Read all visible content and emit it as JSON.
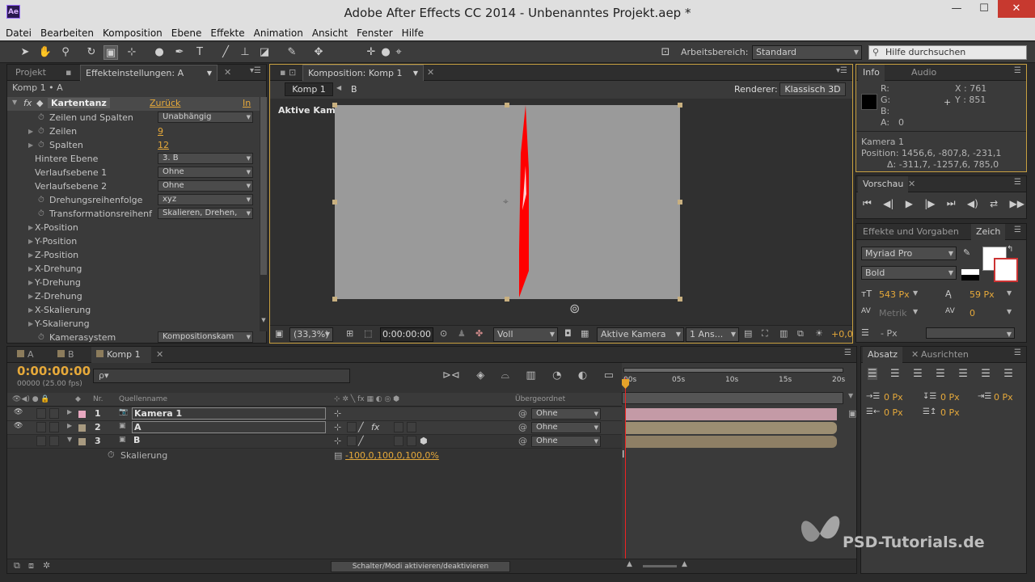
{
  "app": {
    "title": "Adobe After Effects CC 2014 - Unbenanntes Projekt.aep *",
    "logo": "Ae"
  },
  "window_controls": {
    "minimize": "—",
    "maximize": "☐",
    "close": "✕"
  },
  "menu": [
    "Datei",
    "Bearbeiten",
    "Komposition",
    "Ebene",
    "Effekte",
    "Animation",
    "Ansicht",
    "Fenster",
    "Hilfe"
  ],
  "toolbar": {
    "workspace_label": "Arbeitsbereich:",
    "workspace_value": "Standard",
    "search_placeholder": "Hilfe durchsuchen",
    "tools": [
      "selection-tool",
      "hand-tool",
      "zoom-tool",
      "rotate-tool",
      "camera-tool",
      "pan-behind-tool",
      "ellipse-tool",
      "pen-tool",
      "text-tool",
      "brush-tool",
      "clone-stamp-tool",
      "eraser-tool",
      "roto-brush-tool",
      "puppet-tool"
    ]
  },
  "effect_panel": {
    "tab_project": "Projekt",
    "tab_effects": "Effekteinstellungen: A",
    "subtitle": "Komp 1 • A",
    "effect_name": "Kartentanz",
    "reset": "Zurück",
    "info": "In",
    "rows": [
      {
        "label": "Zeilen und Spalten",
        "value": "Unabhängig",
        "kind": "dropdown",
        "stopwatch": true
      },
      {
        "label": "Zeilen",
        "value": "9",
        "kind": "number",
        "stopwatch": true,
        "twirl": true
      },
      {
        "label": "Spalten",
        "value": "12",
        "kind": "number",
        "stopwatch": true,
        "twirl": true
      },
      {
        "label": "Hintere Ebene",
        "value": "3. B",
        "kind": "dropdown"
      },
      {
        "label": "Verlaufsebene 1",
        "value": "Ohne",
        "kind": "dropdown"
      },
      {
        "label": "Verlaufsebene 2",
        "value": "Ohne",
        "kind": "dropdown"
      },
      {
        "label": "Drehungsreihenfolge",
        "value": "xyz",
        "kind": "dropdown",
        "stopwatch": true
      },
      {
        "label": "Transformationsreihenf",
        "value": "Skalieren, Drehen, ",
        "kind": "dropdown",
        "stopwatch": true
      },
      {
        "label": "X-Position",
        "kind": "group",
        "twirl": true
      },
      {
        "label": "Y-Position",
        "kind": "group",
        "twirl": true
      },
      {
        "label": "Z-Position",
        "kind": "group",
        "twirl": true
      },
      {
        "label": "X-Drehung",
        "kind": "group",
        "twirl": true
      },
      {
        "label": "Y-Drehung",
        "kind": "group",
        "twirl": true
      },
      {
        "label": "Z-Drehung",
        "kind": "group",
        "twirl": true
      },
      {
        "label": "X-Skalierung",
        "kind": "group",
        "twirl": true
      },
      {
        "label": "Y-Skalierung",
        "kind": "group",
        "twirl": true
      },
      {
        "label": "Kamerasystem",
        "value": "Kompositionskam",
        "kind": "dropdown",
        "stopwatch": true
      }
    ]
  },
  "comp_panel": {
    "tab": "Komposition: Komp 1",
    "breadcrumb_comp": "Komp 1",
    "breadcrumb_layer": "B",
    "renderer_label": "Renderer:",
    "renderer_value": "Klassisch 3D",
    "view_label": "Aktive Kamera",
    "zoom": "(33,3%)",
    "timecode": "0:00:00:00",
    "resolution": "Voll",
    "camera": "Aktive Kamera",
    "views": "1 Ans...",
    "exposure": "+0,0"
  },
  "info_panel": {
    "tab_info": "Info",
    "tab_audio": "Audio",
    "r": "R:",
    "g": "G:",
    "b": "B:",
    "a": "A:",
    "a_val": "0",
    "x": "X : 761",
    "y": "Y : 851",
    "cam": "Kamera 1",
    "position": "Position: 1456,6, -807,8, -231,1",
    "delta": "Δ: -311,7, -1257,6, 785,0"
  },
  "preview_panel": {
    "tab": "Vorschau"
  },
  "char_panel": {
    "tab_effects": "Effekte und Vorgaben",
    "tab_char": "Zeich",
    "font": "Myriad Pro",
    "style": "Bold",
    "size": "543 Px",
    "leading": "59 Px",
    "kerning": "Metrik",
    "tracking": "0",
    "stroke": "- Px"
  },
  "para_panel": {
    "tab_para": "Absatz",
    "tab_align": "Ausrichten",
    "indent_left": "0 Px",
    "indent_right": "0 Px",
    "indent_first": "0 Px",
    "space_before": "0 Px",
    "space_after": "0 Px"
  },
  "timeline": {
    "tab_a": "A",
    "tab_b": "B",
    "tab_comp": "Komp 1",
    "timecode": "0:00:00:00",
    "frames": "00000 (25.00 fps)",
    "search_placeholder": "ρ▾",
    "col_nr": "Nr.",
    "col_name": "Quellenname",
    "col_parent": "Übergeordnet",
    "ruler": [
      "00s",
      "05s",
      "10s",
      "15s",
      "20s"
    ],
    "layers": [
      {
        "nr": "1",
        "name": "Kamera 1",
        "parent": "Ohne",
        "color": "#e8a8c0",
        "bar": "#c49aa6"
      },
      {
        "nr": "2",
        "name": "A",
        "parent": "Ohne",
        "color": "#a89a80",
        "bar": "#9c8e72"
      },
      {
        "nr": "3",
        "name": "B",
        "parent": "Ohne",
        "color": "#a89a80",
        "bar": "#8e7f65"
      }
    ],
    "sub_prop": "Skalierung",
    "sub_value": "-100,0,100,0,100,0%",
    "bottom_button": "Schalter/Modi aktivieren/deaktivieren"
  },
  "watermark": "PSD-Tutorials.de"
}
